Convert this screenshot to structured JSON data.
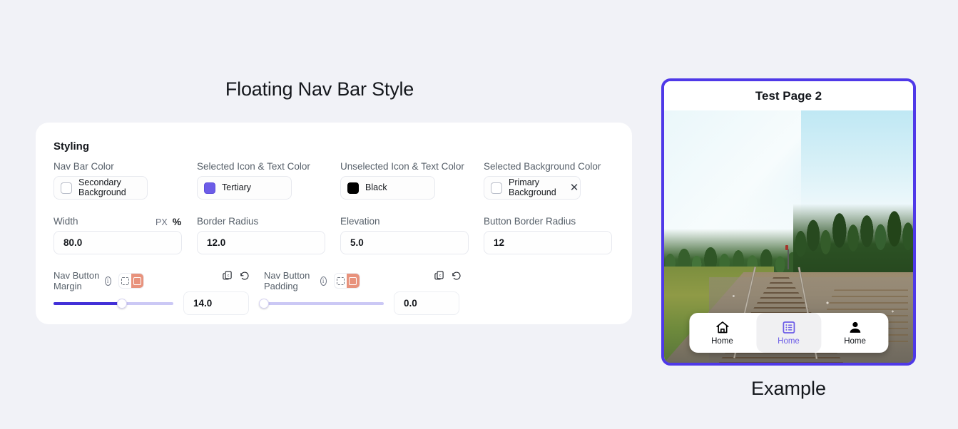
{
  "page": {
    "title": "Floating Nav Bar Style",
    "example_label": "Example",
    "background_color": "#f1f2f7"
  },
  "styling_card": {
    "heading": "Styling",
    "color_fields": [
      {
        "label": "Nav Bar Color",
        "value": "Secondary Background",
        "swatch_kind": "empty",
        "swatch_color": "#ffffff",
        "has_clear": false
      },
      {
        "label": "Selected Icon & Text Color",
        "value": "Tertiary",
        "swatch_kind": "tertiary",
        "swatch_color": "#6c5ce7",
        "has_clear": false
      },
      {
        "label": "Unselected Icon & Text Color",
        "value": "Black",
        "swatch_kind": "black",
        "swatch_color": "#000000",
        "has_clear": false
      },
      {
        "label": "Selected Background Color",
        "value": "Primary Background",
        "swatch_kind": "empty",
        "swatch_color": "#ffffff",
        "has_clear": true,
        "clear_glyph": "✕"
      }
    ],
    "number_fields": [
      {
        "label": "Width",
        "value": "80.0",
        "units": {
          "px": "PX",
          "percent": "%",
          "selected": "percent"
        }
      },
      {
        "label": "Border Radius",
        "value": "12.0"
      },
      {
        "label": "Elevation",
        "value": "5.0"
      },
      {
        "label": "Button Border Radius",
        "value": "12"
      }
    ],
    "slider_groups": [
      {
        "label": "Nav Button Margin",
        "info_glyph": "i",
        "mode_toggle": {
          "options": [
            "individual-sides",
            "all-sides"
          ],
          "selected": "all-sides"
        },
        "copy_icon": "copy-icon",
        "reset_icon": "reset-icon",
        "value": "14.0",
        "fill_percent": 57,
        "thumb_percent": 57
      },
      {
        "label": "Nav Button Padding",
        "info_glyph": "i",
        "mode_toggle": {
          "options": [
            "individual-sides",
            "all-sides"
          ],
          "selected": "all-sides"
        },
        "copy_icon": "copy-icon",
        "reset_icon": "reset-icon",
        "value": "0.0",
        "fill_percent": 0,
        "thumb_percent": 0
      }
    ],
    "slider_colors": {
      "fill": "#4230d8",
      "track": "#cbc8f5",
      "toggle_active": "#e8927c"
    }
  },
  "preview": {
    "header_title": "Test Page 2",
    "frame_border_color": "#4f39e8",
    "photo_description": "railway-track-photo",
    "nav_bar": {
      "items": [
        {
          "icon": "home-icon",
          "label": "Home",
          "selected": false
        },
        {
          "icon": "list-icon",
          "label": "Home",
          "selected": true
        },
        {
          "icon": "person-icon",
          "label": "Home",
          "selected": false
        }
      ],
      "selected_color": "#6c5ce7",
      "unselected_color": "#000000",
      "selected_background": "#f0f0f2",
      "bar_background": "#ffffff"
    }
  }
}
